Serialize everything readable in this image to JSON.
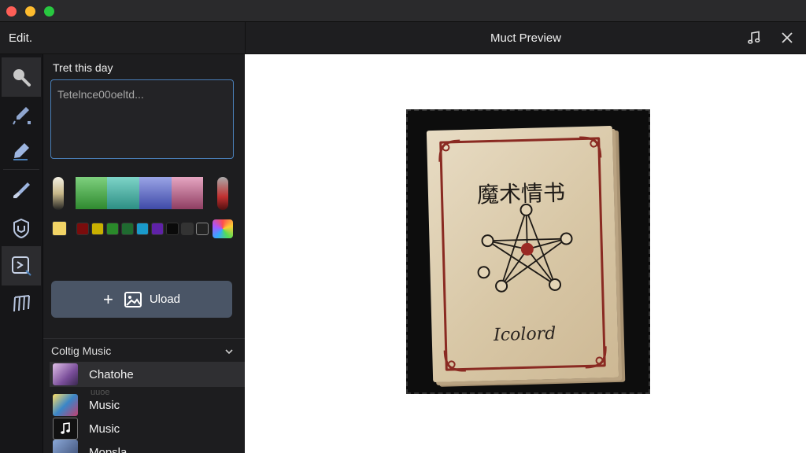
{
  "window": {
    "traffic_lights": [
      "#ff5f57",
      "#febc2e",
      "#28c840"
    ]
  },
  "left_panel": {
    "title": "Edit.",
    "text_section_label": "Tret this day",
    "text_value": "Tetelnce00oeltd...",
    "upload_label": "Uload",
    "dropdown_label": "Coltig Music",
    "list_items": [
      {
        "label": "Chatohe",
        "icon": "image-thumb"
      },
      {
        "label": "Music",
        "icon": "image-thumb"
      },
      {
        "label": "Music",
        "icon": "music-note-thumb"
      },
      {
        "label": "Mopsla",
        "icon": "image-thumb"
      }
    ],
    "ghost_text": "uuoe"
  },
  "toolbar": {
    "tools": [
      "magnifier-icon",
      "eyedropper-icon",
      "pen-icon",
      "brush-icon",
      "shield-icon",
      "play-frame-icon",
      "music-notes-icon"
    ]
  },
  "colors": {
    "big_swatches": [
      "#3c9a3c",
      "#3aa89c",
      "#5a66c0",
      "#c07090"
    ],
    "small_swatches": [
      "#f2d466",
      "#7a0c0c",
      "#c9b000",
      "#2a8a2a",
      "#1f6b30",
      "#1a9acb",
      "#5f22a8",
      "#0a0a0a",
      "#333333",
      "#222222"
    ],
    "accent": "#4a7fb8"
  },
  "preview": {
    "title": "Muct Preview",
    "card_title": "魔术情书",
    "card_signature": "Icolord"
  }
}
